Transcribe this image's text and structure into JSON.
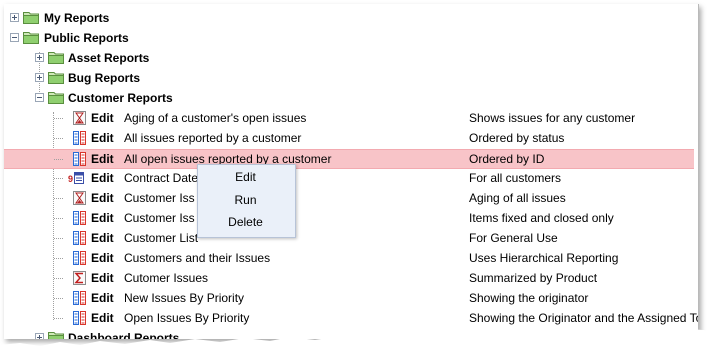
{
  "tree": {
    "my_reports": "My Reports",
    "public_reports": "Public Reports",
    "asset_reports": "Asset Reports",
    "bug_reports": "Bug Reports",
    "customer_reports": "Customer Reports",
    "dashboard_reports": "Dashboard Reports"
  },
  "reports": [
    {
      "edit": "Edit",
      "name": "Aging of a customer's open issues",
      "desc": "Shows issues for any customer",
      "icon": "hourglass-icon"
    },
    {
      "edit": "Edit",
      "name": "All issues reported by a customer",
      "desc": "Ordered by status",
      "icon": "list-report-icon"
    },
    {
      "edit": "Edit",
      "name": "All open issues reported by a customer",
      "desc": "Ordered by ID",
      "icon": "list-report-icon"
    },
    {
      "edit": "Edit",
      "name": "Contract Date",
      "desc": "For all customers",
      "icon": "calendar-icon"
    },
    {
      "edit": "Edit",
      "name": "Customer Iss",
      "desc": "Aging of all issues",
      "icon": "hourglass-icon"
    },
    {
      "edit": "Edit",
      "name": "Customer Iss",
      "desc": "Items fixed and closed only",
      "icon": "list-report-icon"
    },
    {
      "edit": "Edit",
      "name": "Customer List",
      "desc": "For General Use",
      "icon": "list-report-icon"
    },
    {
      "edit": "Edit",
      "name": "Customers and their Issues",
      "desc": "Uses Hierarchical Reporting",
      "icon": "list-report-icon"
    },
    {
      "edit": "Edit",
      "name": "Cutomer Issues",
      "desc": "Summarized by Product",
      "icon": "sigma-icon"
    },
    {
      "edit": "Edit",
      "name": "New Issues By Priority",
      "desc": "Showing the originator",
      "icon": "list-report-icon"
    },
    {
      "edit": "Edit",
      "name": "Open Issues By Priority",
      "desc": "Showing the Originator and the Assigned To",
      "icon": "list-report-icon"
    }
  ],
  "context_menu": {
    "edit": "Edit",
    "run": "Run",
    "delete": "Delete"
  },
  "colors": {
    "highlight": "#f8c4c8",
    "menu_bg": "#eaf0f9",
    "folder": "#7fc06a"
  }
}
